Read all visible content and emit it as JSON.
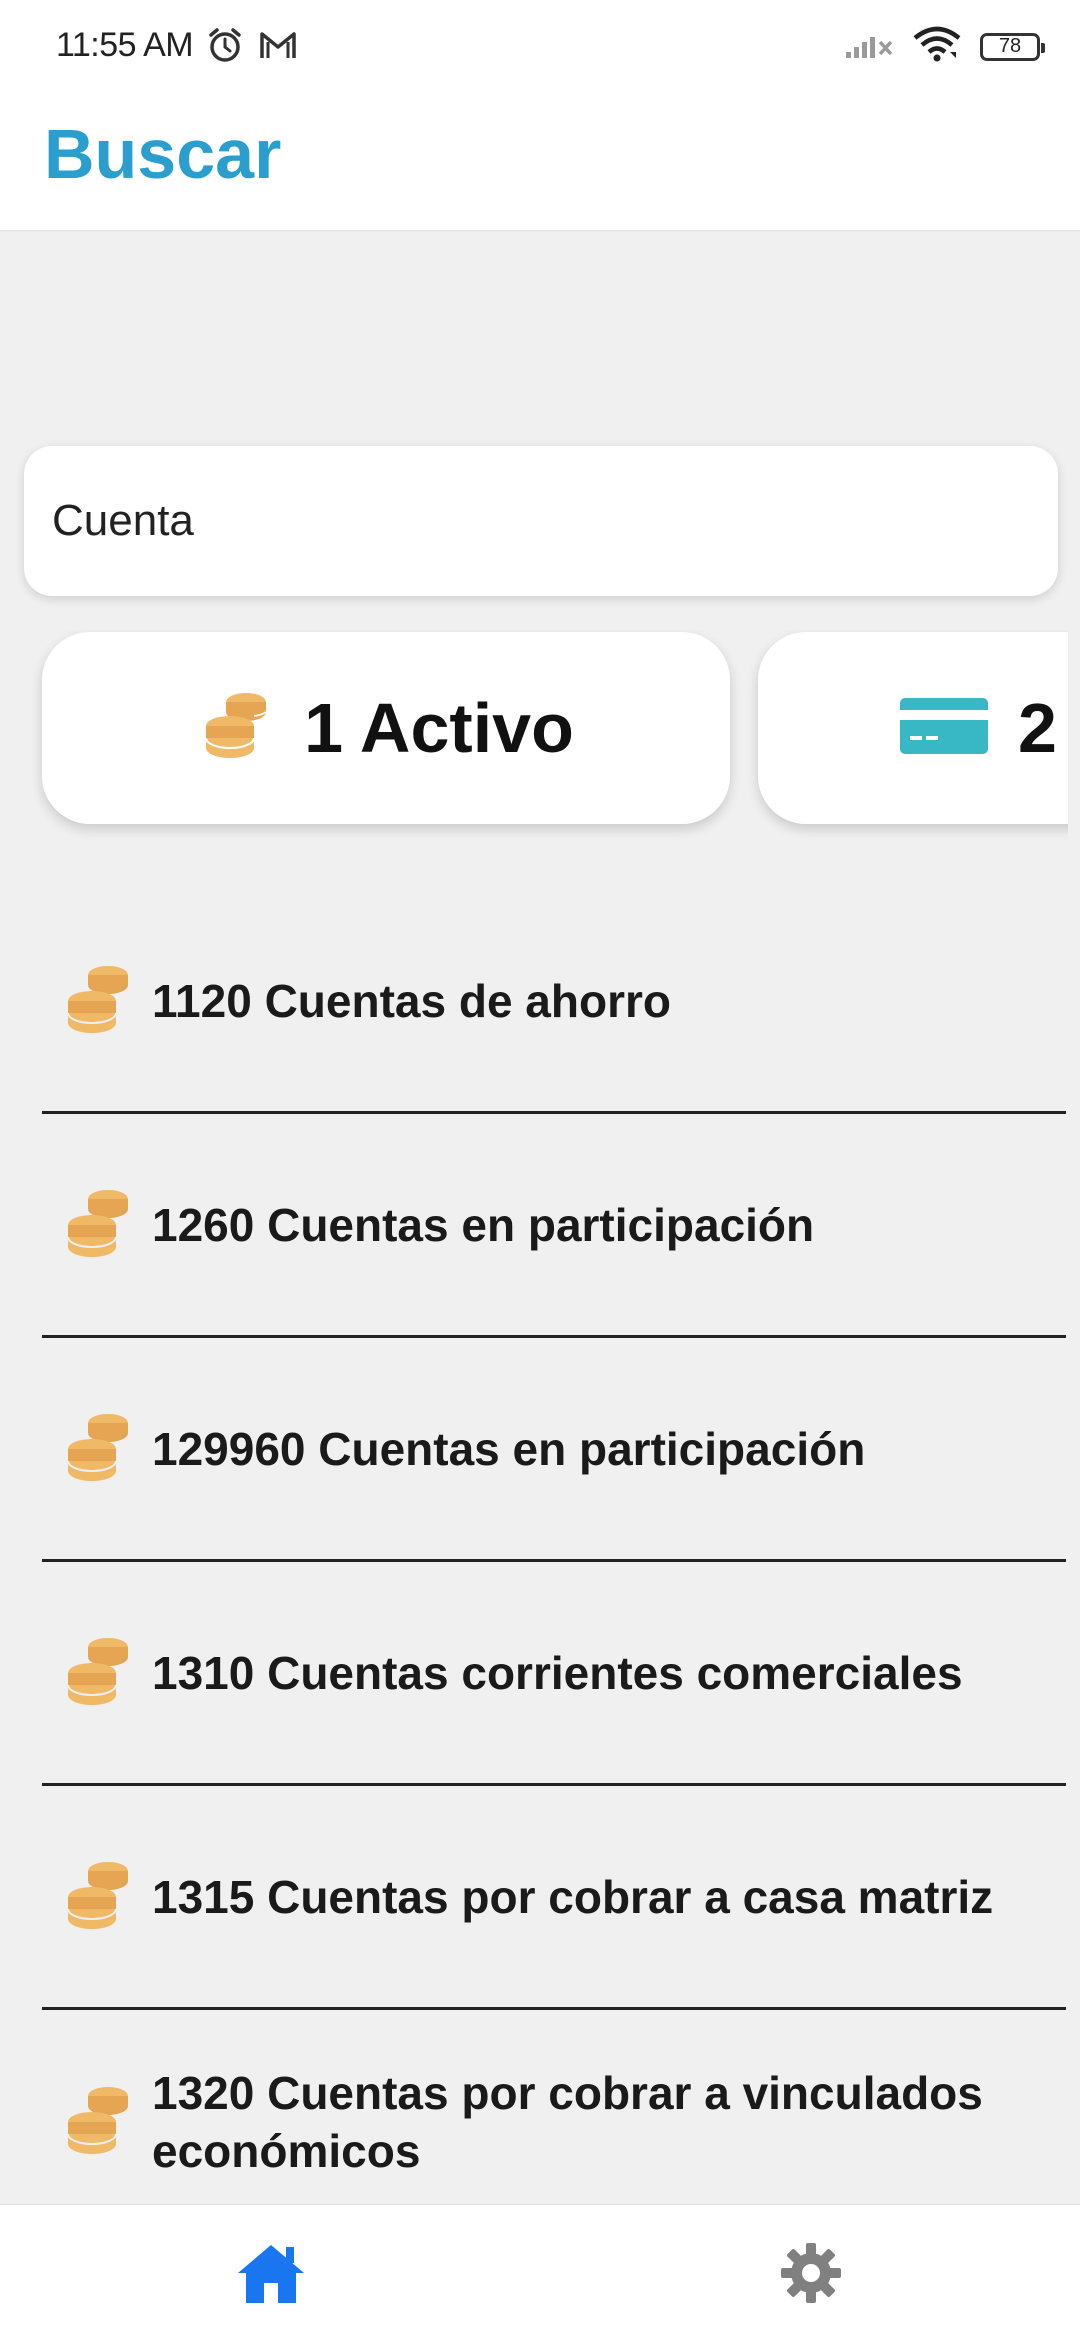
{
  "status_bar": {
    "time": "11:55 AM",
    "battery_level": "78",
    "icons": [
      "alarm-icon",
      "gmail-icon",
      "signal-icon",
      "wifi-icon",
      "battery-icon"
    ]
  },
  "header": {
    "title": "Buscar"
  },
  "search": {
    "value": "Cuenta"
  },
  "categories": [
    {
      "label": "1 Activo",
      "icon": "coins-icon"
    },
    {
      "label": "2",
      "icon": "credit-card-icon"
    }
  ],
  "results": [
    {
      "label": "1120 Cuentas de ahorro",
      "icon": "coins-icon"
    },
    {
      "label": "1260 Cuentas en participación",
      "icon": "coins-icon"
    },
    {
      "label": "129960 Cuentas en participación",
      "icon": "coins-icon"
    },
    {
      "label": "1310 Cuentas corrientes comerciales",
      "icon": "coins-icon"
    },
    {
      "label": "1315 Cuentas por cobrar a casa matriz",
      "icon": "coins-icon"
    },
    {
      "label": "1320 Cuentas por cobrar a vinculados económicos",
      "icon": "coins-icon"
    }
  ],
  "bottom_nav": {
    "items": [
      {
        "icon": "home-icon",
        "active": true
      },
      {
        "icon": "gear-icon",
        "active": false
      }
    ]
  },
  "colors": {
    "title": "#2a9fcd",
    "coins": "#f0b968",
    "card": "#38b8c4",
    "nav_active": "#1976f0",
    "nav_inactive": "#808080"
  }
}
